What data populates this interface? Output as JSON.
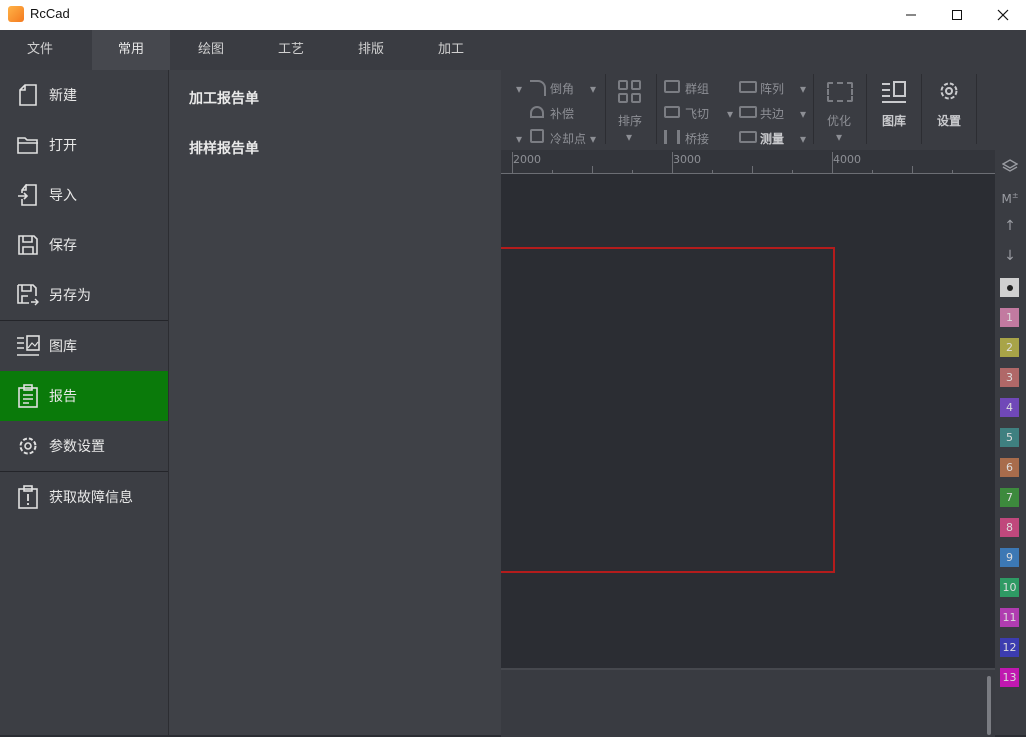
{
  "window": {
    "title": "RcCad"
  },
  "menu": {
    "tabs": [
      "文件",
      "常用",
      "绘图",
      "工艺",
      "排版",
      "加工"
    ]
  },
  "ribbon": {
    "chamfer": "倒角",
    "compensate": "补偿",
    "cooling_point": "冷却点",
    "sort": "排序",
    "group": "群组",
    "fly_cut": "飞切",
    "bridge": "桥接",
    "array": "阵列",
    "common_edge": "共边",
    "measure": "测量",
    "optimize": "优化",
    "library": "图库",
    "settings": "设置"
  },
  "ruler": {
    "labels": [
      "2000",
      "3000",
      "4000"
    ]
  },
  "palette": {
    "m_label": "M",
    "swatches": [
      {
        "label": "",
        "color": "#d0d0d0"
      },
      {
        "label": "1",
        "color": "#c27aa0"
      },
      {
        "label": "2",
        "color": "#a8a448"
      },
      {
        "label": "3",
        "color": "#b06868"
      },
      {
        "label": "4",
        "color": "#7048b8"
      },
      {
        "label": "5",
        "color": "#3f8080"
      },
      {
        "label": "6",
        "color": "#a86c4c"
      },
      {
        "label": "7",
        "color": "#3d8a3d"
      },
      {
        "label": "8",
        "color": "#c0487c"
      },
      {
        "label": "9",
        "color": "#3c78b4"
      },
      {
        "label": "10",
        "color": "#2e9a64"
      },
      {
        "label": "11",
        "color": "#b03cb0"
      },
      {
        "label": "12",
        "color": "#3c3cb0"
      },
      {
        "label": "13",
        "color": "#c018b0"
      }
    ]
  },
  "file_menu": {
    "items": [
      {
        "label": "新建",
        "icon": "new-file-icon"
      },
      {
        "label": "打开",
        "icon": "folder-open-icon"
      },
      {
        "label": "导入",
        "icon": "import-icon"
      },
      {
        "label": "保存",
        "icon": "save-icon"
      },
      {
        "label": "另存为",
        "icon": "save-as-icon"
      },
      {
        "label": "图库",
        "icon": "library-icon"
      },
      {
        "label": "报告",
        "icon": "report-icon"
      },
      {
        "label": "参数设置",
        "icon": "gear-icon"
      },
      {
        "label": "获取故障信息",
        "icon": "fault-info-icon"
      }
    ],
    "submenu": [
      "加工报告单",
      "排样报告单"
    ]
  },
  "colors": {
    "active": "#0a7a0a",
    "outline": "#b41c1c"
  }
}
